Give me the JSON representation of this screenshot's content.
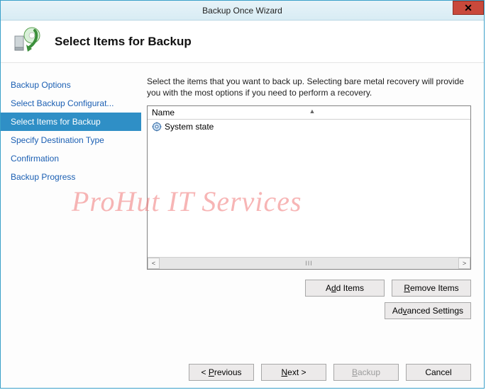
{
  "window": {
    "title": "Backup Once Wizard"
  },
  "header": {
    "title": "Select Items for Backup"
  },
  "sidebar": {
    "steps": [
      {
        "label": "Backup Options"
      },
      {
        "label": "Select Backup Configurat..."
      },
      {
        "label": "Select Items for Backup"
      },
      {
        "label": "Specify Destination Type"
      },
      {
        "label": "Confirmation"
      },
      {
        "label": "Backup Progress"
      }
    ],
    "active_index": 2
  },
  "main": {
    "instruction": "Select the items that you want to back up. Selecting bare metal recovery will provide you with the most options if you need to perform a recovery.",
    "column_header": "Name",
    "items": [
      {
        "label": "System state"
      }
    ],
    "buttons": {
      "add": {
        "pre": "A",
        "ul": "d",
        "post": "d Items"
      },
      "remove": {
        "pre": "",
        "ul": "R",
        "post": "emove Items"
      },
      "advanced": {
        "pre": "Ad",
        "ul": "v",
        "post": "anced Settings"
      }
    }
  },
  "footer": {
    "previous": {
      "pre": "< ",
      "ul": "P",
      "post": "revious"
    },
    "next": {
      "pre": "",
      "ul": "N",
      "post": "ext >"
    },
    "backup": {
      "pre": "",
      "ul": "B",
      "post": "ackup"
    },
    "cancel": "Cancel"
  },
  "watermark": "ProHut IT Services"
}
